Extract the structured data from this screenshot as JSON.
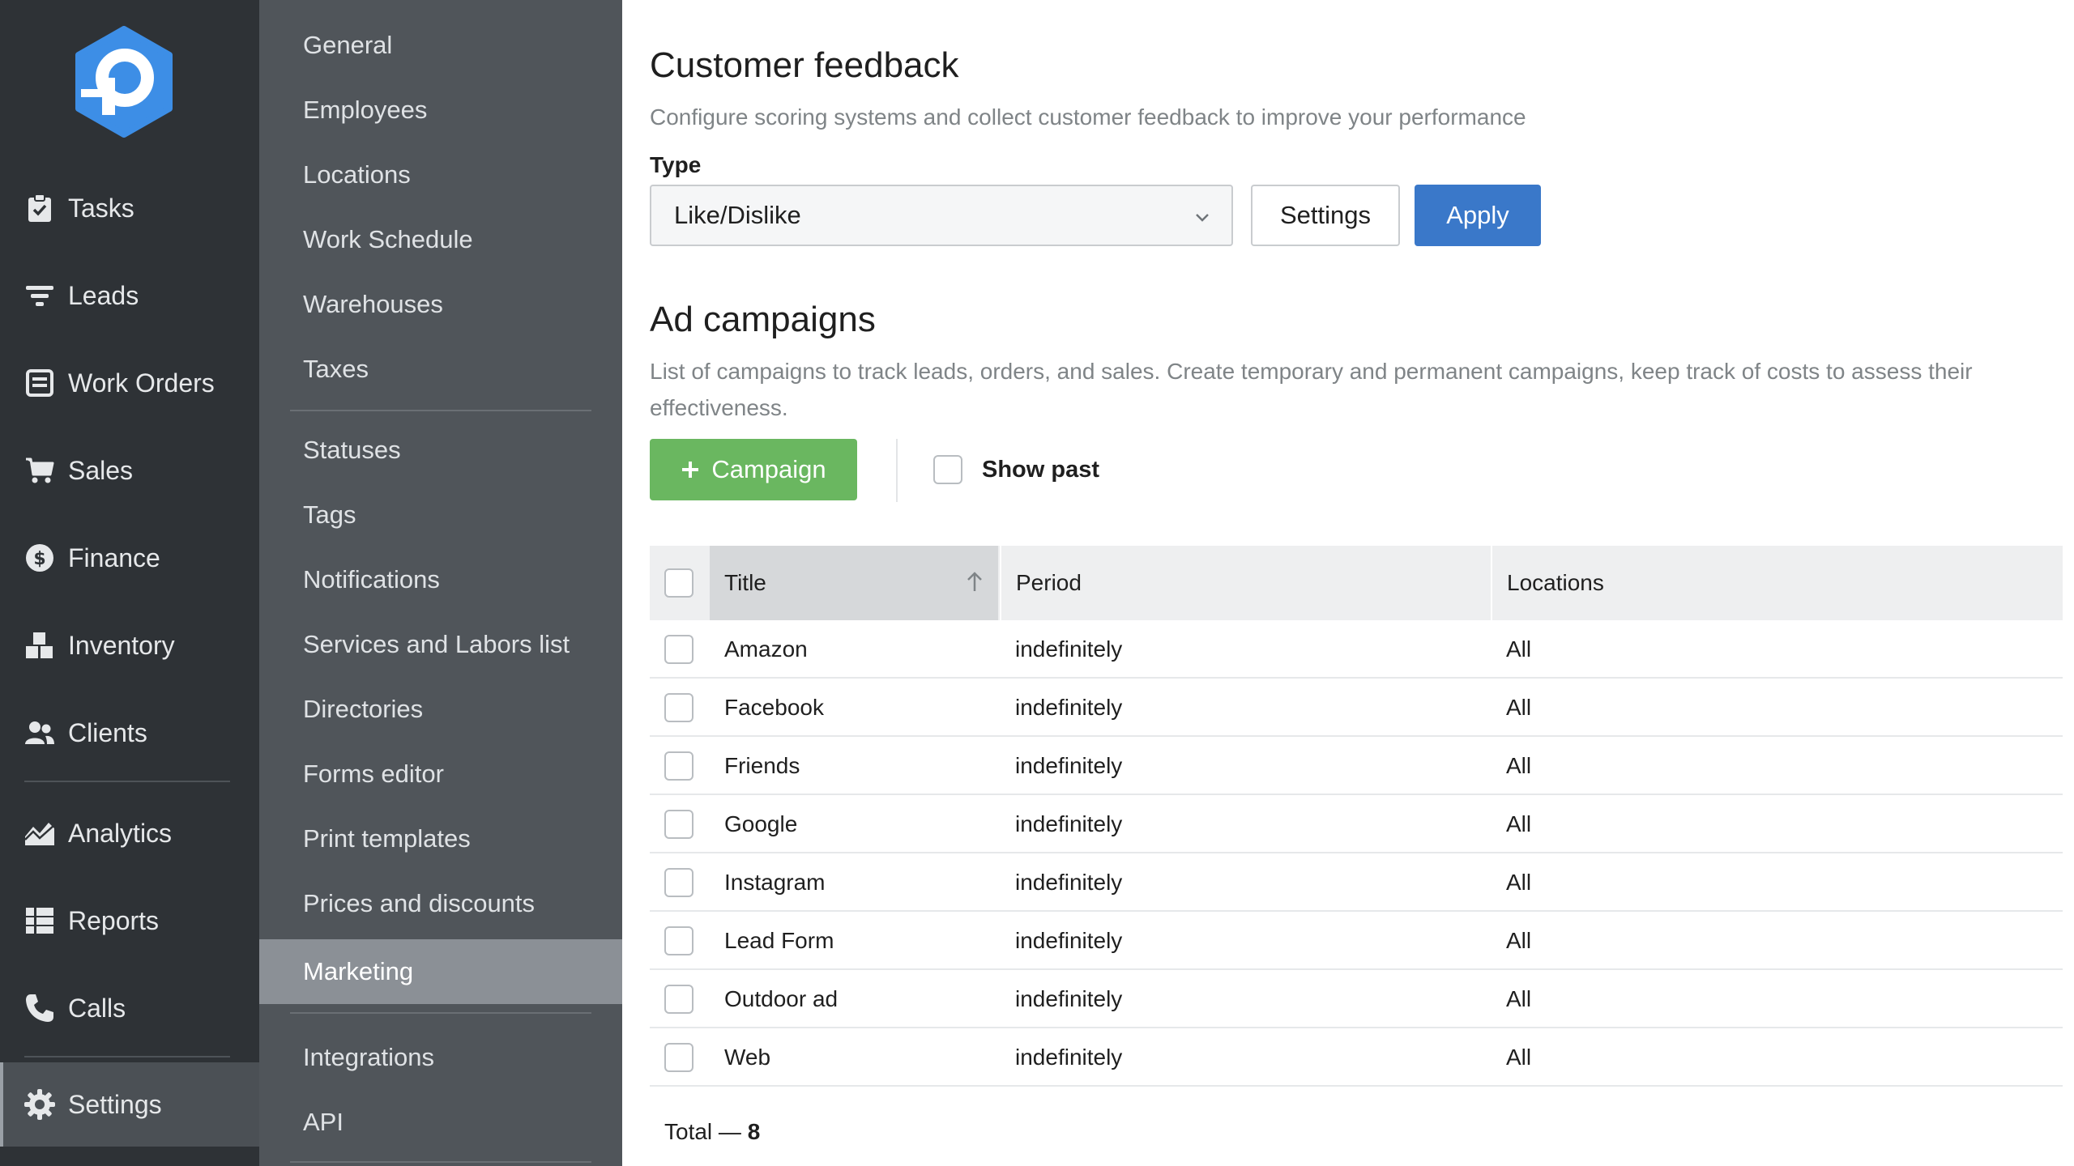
{
  "colors": {
    "nav_bg": "#2e3236",
    "submenu_bg": "#50555a",
    "submenu_active_bg": "#8b9096",
    "logo_blue": "#3d8ee6",
    "apply_blue": "#3a78c9",
    "campaign_green": "#6ab760"
  },
  "nav": {
    "items": [
      {
        "label": "Tasks",
        "icon": "clipboard-icon"
      },
      {
        "label": "Leads",
        "icon": "funnel-icon"
      },
      {
        "label": "Work Orders",
        "icon": "work-order-icon"
      },
      {
        "label": "Sales",
        "icon": "cart-icon"
      },
      {
        "label": "Finance",
        "icon": "dollar-icon"
      },
      {
        "label": "Inventory",
        "icon": "boxes-icon"
      },
      {
        "label": "Clients",
        "icon": "users-icon"
      },
      {
        "label": "Analytics",
        "icon": "chart-icon"
      },
      {
        "label": "Reports",
        "icon": "table-icon"
      },
      {
        "label": "Calls",
        "icon": "phone-icon"
      },
      {
        "label": "Settings",
        "icon": "gear-icon",
        "active": true
      }
    ]
  },
  "submenu": {
    "items": [
      {
        "label": "General"
      },
      {
        "label": "Employees"
      },
      {
        "label": "Locations"
      },
      {
        "label": "Work Schedule"
      },
      {
        "label": "Warehouses"
      },
      {
        "label": "Taxes"
      },
      {
        "label": "Statuses"
      },
      {
        "label": "Tags"
      },
      {
        "label": "Notifications"
      },
      {
        "label": "Services and Labors list"
      },
      {
        "label": "Directories"
      },
      {
        "label": "Forms editor"
      },
      {
        "label": "Print templates"
      },
      {
        "label": "Prices and discounts"
      },
      {
        "label": "Marketing",
        "active": true
      },
      {
        "label": "Integrations"
      },
      {
        "label": "API"
      }
    ]
  },
  "feedback": {
    "title": "Customer feedback",
    "description": "Configure scoring systems and collect customer feedback to improve your performance",
    "type_label": "Type",
    "type_value": "Like/Dislike",
    "settings_label": "Settings",
    "apply_label": "Apply"
  },
  "campaigns": {
    "title": "Ad campaigns",
    "description_line1": "List of campaigns to track leads, orders, and sales. Create temporary and permanent campaigns, keep track of costs to assess their",
    "description_line2": "effectiveness.",
    "add_label": "Campaign",
    "show_past_label": "Show past",
    "columns": {
      "title": "Title",
      "period": "Period",
      "locations": "Locations"
    },
    "rows": [
      {
        "title": "Amazon",
        "period": "indefinitely",
        "locations": "All"
      },
      {
        "title": "Facebook",
        "period": "indefinitely",
        "locations": "All"
      },
      {
        "title": "Friends",
        "period": "indefinitely",
        "locations": "All"
      },
      {
        "title": "Google",
        "period": "indefinitely",
        "locations": "All"
      },
      {
        "title": "Instagram",
        "period": "indefinitely",
        "locations": "All"
      },
      {
        "title": "Lead Form",
        "period": "indefinitely",
        "locations": "All"
      },
      {
        "title": "Outdoor ad",
        "period": "indefinitely",
        "locations": "All"
      },
      {
        "title": "Web",
        "period": "indefinitely",
        "locations": "All"
      }
    ],
    "total_label": "Total —",
    "total_value": "8"
  }
}
